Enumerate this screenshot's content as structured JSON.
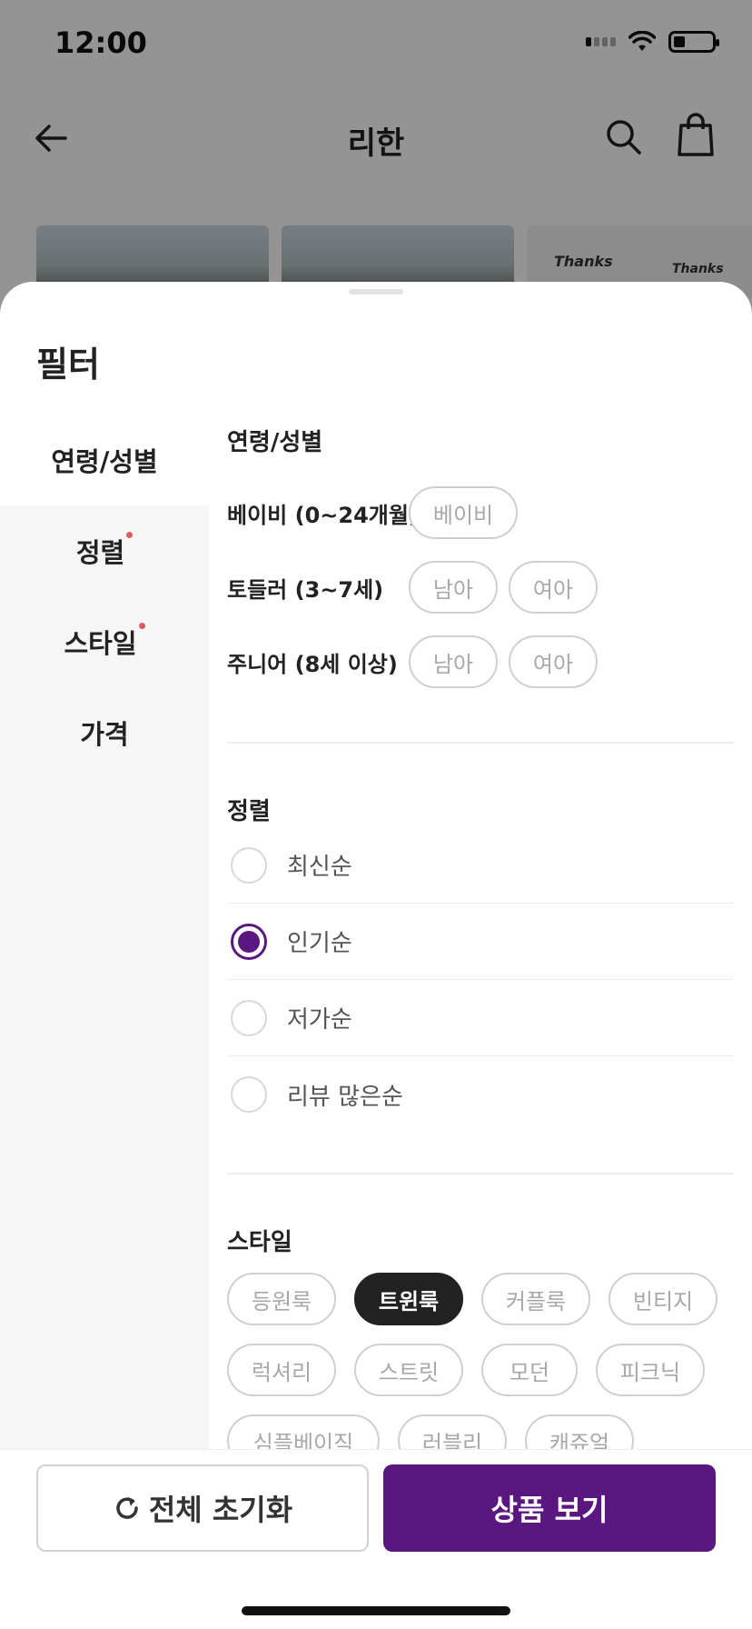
{
  "status_bar": {
    "time": "12:00"
  },
  "nav": {
    "title": "리한"
  },
  "thumbs": {
    "tee_text_1": "Thanks",
    "tee_text_2": "Thanks"
  },
  "sheet": {
    "title": "필터"
  },
  "sidebar": {
    "items": [
      {
        "label": "연령/성별",
        "active": true,
        "dot": false
      },
      {
        "label": "정렬",
        "active": false,
        "dot": true
      },
      {
        "label": "스타일",
        "active": false,
        "dot": true
      },
      {
        "label": "가격",
        "active": false,
        "dot": false
      }
    ]
  },
  "age_section": {
    "title": "연령/성별",
    "rows": [
      {
        "label": "베이비 (0~24개월)",
        "chips": [
          "베이비"
        ]
      },
      {
        "label": "토들러 (3~7세)",
        "chips": [
          "남아",
          "여아"
        ]
      },
      {
        "label": "주니어 (8세 이상)",
        "chips": [
          "남아",
          "여아"
        ]
      }
    ]
  },
  "sort_section": {
    "title": "정렬",
    "options": [
      {
        "label": "최신순",
        "selected": false
      },
      {
        "label": "인기순",
        "selected": true
      },
      {
        "label": "저가순",
        "selected": false
      },
      {
        "label": "리뷰 많은순",
        "selected": false
      }
    ]
  },
  "style_section": {
    "title": "스타일",
    "rows": [
      [
        {
          "label": "등원룩",
          "selected": false
        },
        {
          "label": "트윈룩",
          "selected": true
        },
        {
          "label": "커플룩",
          "selected": false
        },
        {
          "label": "빈티지",
          "selected": false
        }
      ],
      [
        {
          "label": "럭셔리",
          "selected": false
        },
        {
          "label": "스트릿",
          "selected": false
        },
        {
          "label": "모던",
          "selected": false
        },
        {
          "label": "피크닉",
          "selected": false
        }
      ],
      [
        {
          "label": "심플베이직",
          "selected": false
        },
        {
          "label": "러블리",
          "selected": false
        },
        {
          "label": "캐쥬얼",
          "selected": false
        }
      ]
    ]
  },
  "bottom": {
    "reset_label": "전체 초기화",
    "view_label": "상품 보기"
  },
  "colors": {
    "accent": "#5b1780",
    "chip_selected": "#222222",
    "badge_dot": "#e35a5a"
  }
}
